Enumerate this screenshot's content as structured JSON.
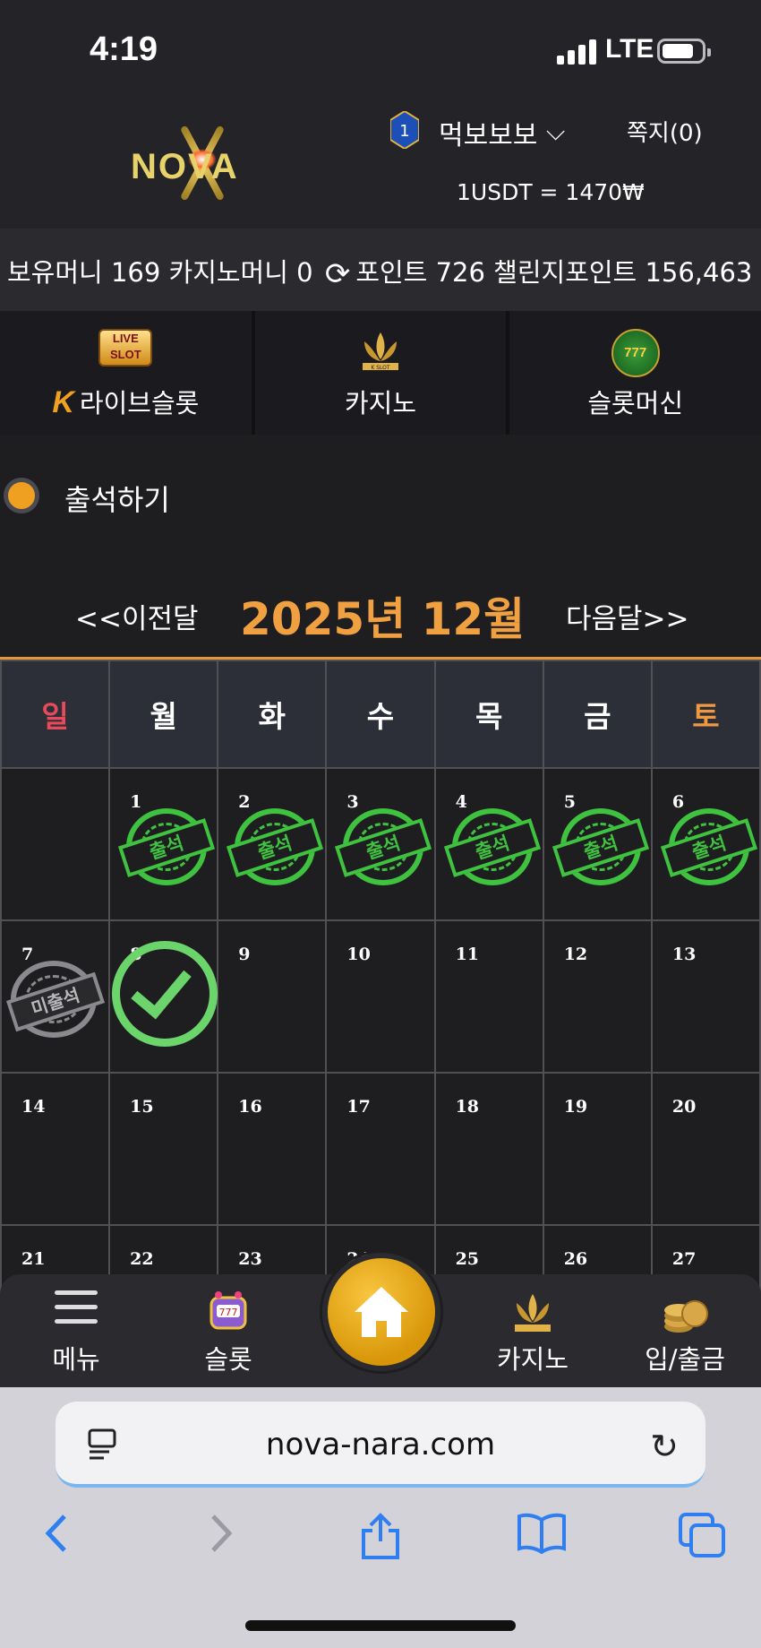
{
  "status": {
    "time": "4:19",
    "network": "LTE"
  },
  "header": {
    "logo_text": "NOVA",
    "rank_level": "1",
    "username": "먹보보보",
    "messages": "쪽지(0)",
    "rate": "1USDT = 1470₩"
  },
  "balance": {
    "money": "보유머니 169",
    "casino_money": "카지노머니 0",
    "points": "포인트 726",
    "challenge_points": "챌린지포인트 156,463"
  },
  "game_tabs": [
    {
      "label": "라이브슬롯",
      "icon": "live-slot-icon",
      "badge_text": "LIVE SLOT"
    },
    {
      "label": "카지노",
      "icon": "lotus-k-slot-icon",
      "badge_text": "K SLOT"
    },
    {
      "label": "슬롯머신",
      "icon": "777-slots-icon",
      "badge_text": "777"
    }
  ],
  "attendance": {
    "title": "출석하기",
    "prev": "<<이전달",
    "month": "2025년 12월",
    "next": "다음달>>",
    "weekdays": [
      "일",
      "월",
      "화",
      "수",
      "목",
      "금",
      "토"
    ],
    "stamp_attended": "출석",
    "stamp_missed": "미출석",
    "weeks": [
      [
        "",
        "1",
        "2",
        "3",
        "4",
        "5",
        "6"
      ],
      [
        "7",
        "8",
        "9",
        "10",
        "11",
        "12",
        "13"
      ],
      [
        "14",
        "15",
        "16",
        "17",
        "18",
        "19",
        "20"
      ],
      [
        "21",
        "22",
        "23",
        "24",
        "25",
        "26",
        "27"
      ]
    ],
    "attended_days": [
      "1",
      "2",
      "3",
      "4",
      "5",
      "6"
    ],
    "missed_days": [
      "7"
    ],
    "today": "8"
  },
  "bottom_nav": {
    "menu": "메뉴",
    "slot": "슬롯",
    "casino": "카지노",
    "deposit": "입/출금"
  },
  "browser": {
    "url": "nova-nara.com"
  },
  "colors": {
    "accent": "#f0a040",
    "stamp_green": "#3fc23f",
    "sunday": "#e84a5a"
  }
}
